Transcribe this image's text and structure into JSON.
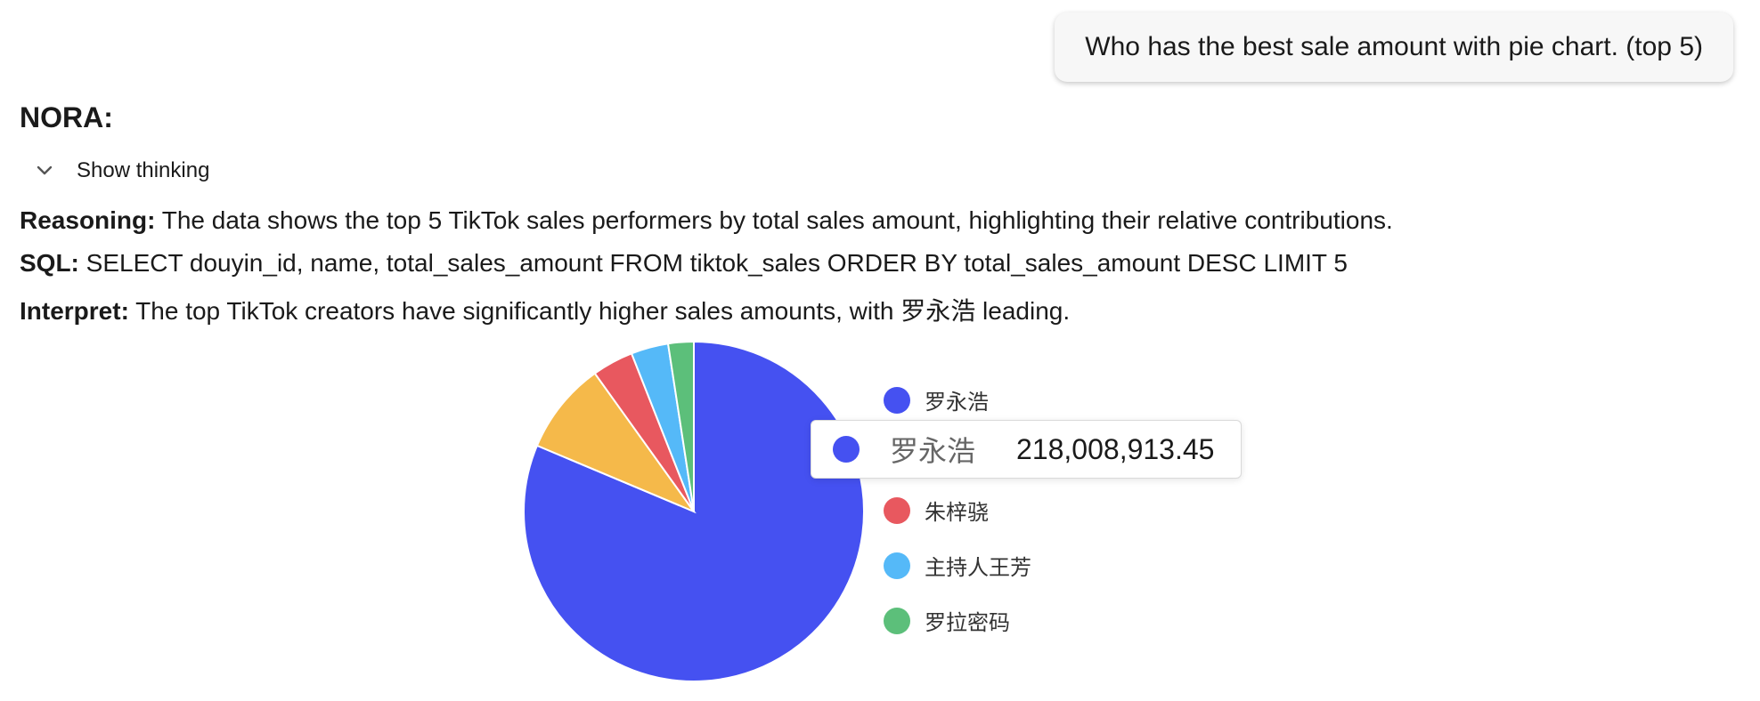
{
  "user_message": "Who has the best sale amount with pie chart. (top 5)",
  "assistant": {
    "name": "NORA:",
    "thinking_toggle_label": "Show thinking",
    "reasoning_label": "Reasoning:",
    "reasoning_text": " The data shows the top 5 TikTok sales performers by total sales amount, highlighting their relative contributions.",
    "sql_label": "SQL:",
    "sql_text": " SELECT douyin_id, name, total_sales_amount FROM tiktok_sales ORDER BY total_sales_amount DESC LIMIT 5",
    "interpret_label": "Interpret:",
    "interpret_text": " The top TikTok creators have significantly higher sales amounts, with 罗永浩 leading."
  },
  "chart_data": {
    "type": "pie",
    "title": "",
    "labels": [
      "罗永浩",
      "",
      "朱梓骁",
      "主持人王芳",
      "罗拉密码"
    ],
    "values": [
      218008913.45,
      23500000,
      10500000,
      9500000,
      6500000
    ],
    "colors": [
      "#4551f1",
      "#f5b94a",
      "#e8585f",
      "#55b9f8",
      "#5cbf7a"
    ],
    "legend_position": "right",
    "tooltip": {
      "name": "罗永浩",
      "value": "218,008,913.45",
      "color": "#4551f1"
    }
  },
  "icons": {
    "thinking_toggle": "chevron-down-icon"
  }
}
